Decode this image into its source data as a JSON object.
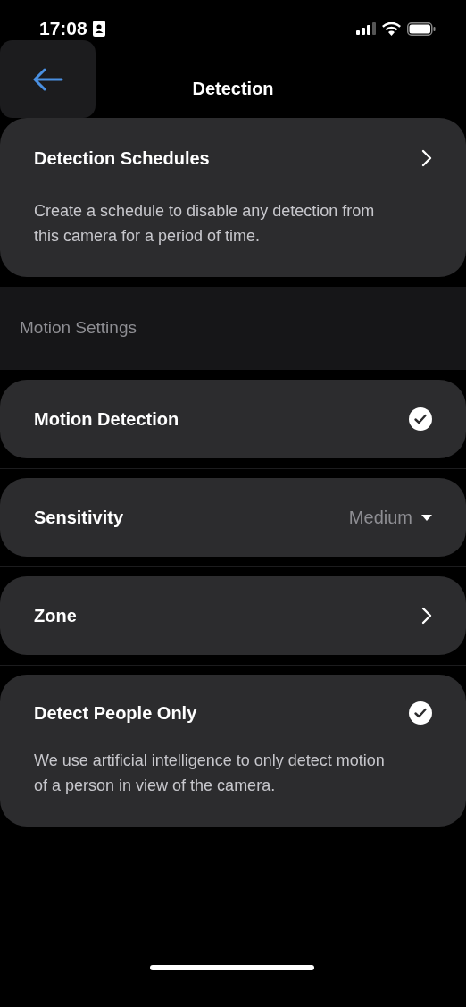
{
  "status_bar": {
    "time": "17:08"
  },
  "header": {
    "title": "Detection"
  },
  "schedules": {
    "title": "Detection Schedules",
    "description": "Create a schedule to disable any detection from this camera for a period of time."
  },
  "section": {
    "title": "Motion Settings"
  },
  "rows": [
    {
      "kind": "check",
      "label": "Motion Detection",
      "checked": true
    },
    {
      "kind": "dropdown",
      "label": "Sensitivity",
      "value": "Medium"
    },
    {
      "kind": "link",
      "label": "Zone"
    },
    {
      "kind": "check",
      "label": "Detect People Only",
      "checked": true,
      "description": "We use artificial intelligence to only detect motion of a person in view of the camera."
    }
  ]
}
